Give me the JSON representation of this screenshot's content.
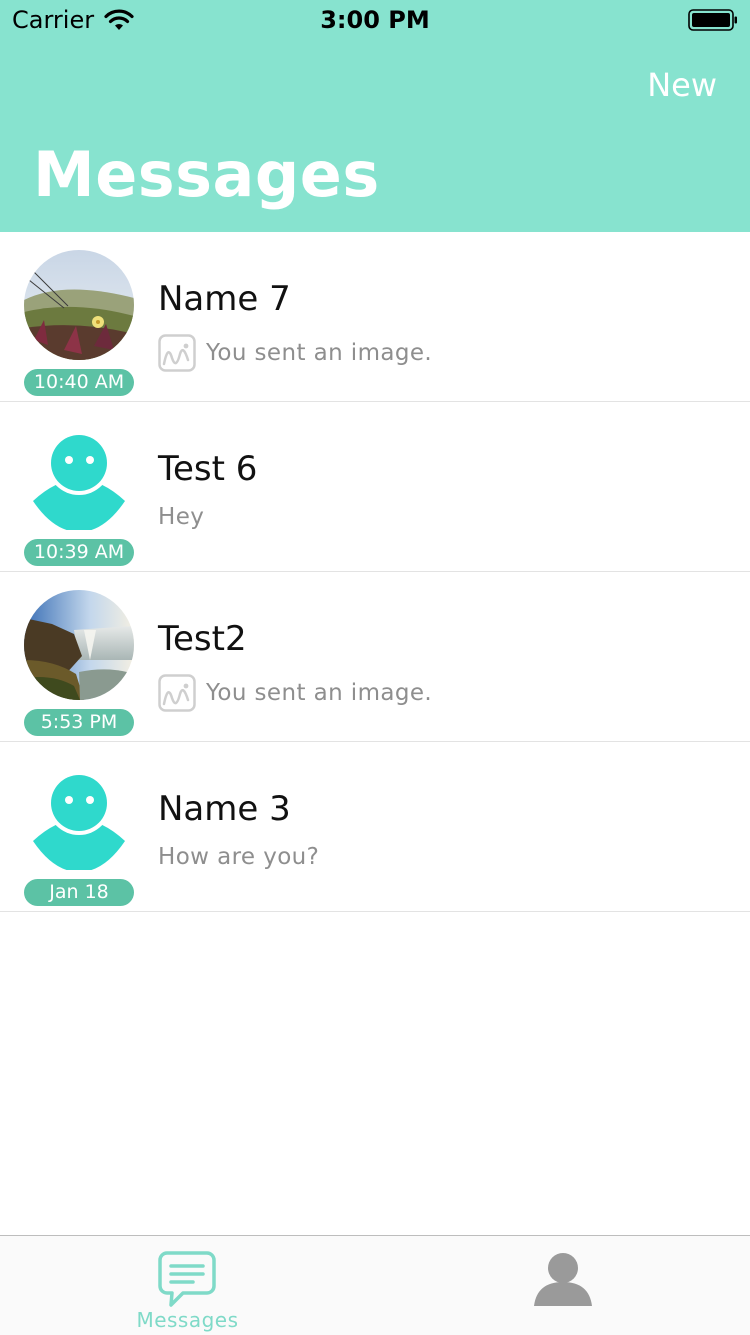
{
  "status_bar": {
    "carrier": "Carrier",
    "time": "3:00 PM"
  },
  "header": {
    "new_label": "New",
    "title": "Messages",
    "background_color": "#87e3cf"
  },
  "conversations": [
    {
      "name": "Name 7",
      "time": "10:40 AM",
      "preview": "You sent an image.",
      "preview_icon": "image-icon",
      "avatar": "photo-flowers"
    },
    {
      "name": "Test 6",
      "time": "10:39 AM",
      "preview": "Hey",
      "preview_icon": "",
      "avatar": "default-person"
    },
    {
      "name": "Test2",
      "time": "5:53 PM",
      "preview": "You sent an image.",
      "preview_icon": "image-icon",
      "avatar": "photo-waterfall"
    },
    {
      "name": "Name 3",
      "time": "Jan 18",
      "preview": "How are you?",
      "preview_icon": "",
      "avatar": "default-person"
    }
  ],
  "tab_bar": {
    "messages_label": "Messages",
    "active_color": "#7fdac8",
    "inactive_color": "#9a9a9a"
  }
}
